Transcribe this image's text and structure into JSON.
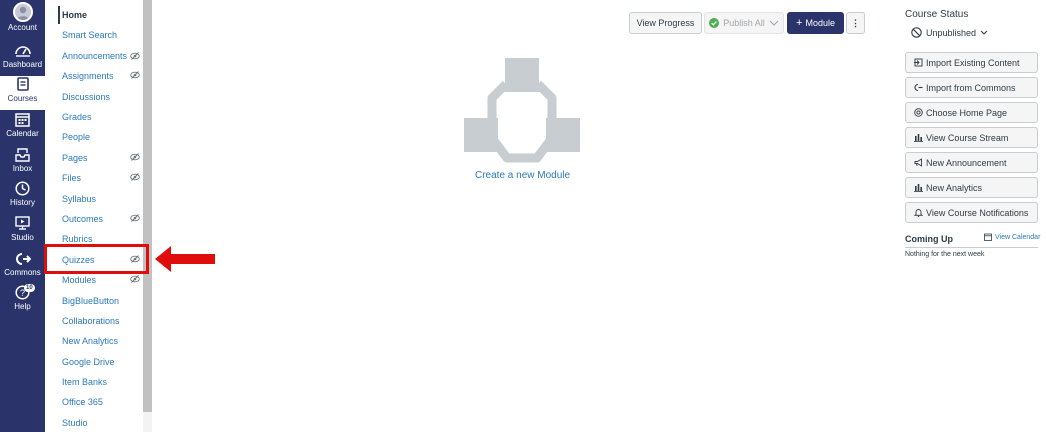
{
  "global_nav": {
    "items": [
      {
        "label": "Account",
        "icon": "account-avatar-icon"
      },
      {
        "label": "Dashboard",
        "icon": "dashboard-icon"
      },
      {
        "label": "Courses",
        "icon": "courses-icon",
        "active": true
      },
      {
        "label": "Calendar",
        "icon": "calendar-icon"
      },
      {
        "label": "Inbox",
        "icon": "inbox-icon"
      },
      {
        "label": "History",
        "icon": "history-clock-icon"
      },
      {
        "label": "Studio",
        "icon": "studio-icon"
      },
      {
        "label": "Commons",
        "icon": "commons-icon"
      },
      {
        "label": "Help",
        "icon": "help-icon",
        "badge": "10"
      }
    ]
  },
  "course_nav": {
    "items": [
      {
        "label": "Home",
        "active": true,
        "hidden": false
      },
      {
        "label": "Smart Search",
        "hidden": false
      },
      {
        "label": "Announcements",
        "hidden": true
      },
      {
        "label": "Assignments",
        "hidden": true
      },
      {
        "label": "Discussions",
        "hidden": false
      },
      {
        "label": "Grades",
        "hidden": false
      },
      {
        "label": "People",
        "hidden": false
      },
      {
        "label": "Pages",
        "hidden": true
      },
      {
        "label": "Files",
        "hidden": true
      },
      {
        "label": "Syllabus",
        "hidden": false
      },
      {
        "label": "Outcomes",
        "hidden": true
      },
      {
        "label": "Rubrics",
        "hidden": false
      },
      {
        "label": "Quizzes",
        "hidden": true,
        "highlighted": true
      },
      {
        "label": "Modules",
        "hidden": true
      },
      {
        "label": "BigBlueButton",
        "hidden": false
      },
      {
        "label": "Collaborations",
        "hidden": false
      },
      {
        "label": "New Analytics",
        "hidden": false
      },
      {
        "label": "Google Drive",
        "hidden": false
      },
      {
        "label": "Item Banks",
        "hidden": false
      },
      {
        "label": "Office 365",
        "hidden": false
      },
      {
        "label": "Studio",
        "hidden": false
      }
    ]
  },
  "toolbar": {
    "view_progress": "View Progress",
    "publish_all": "Publish All",
    "add_module": "Module",
    "add_module_prefix": "+",
    "more_options": "⋮"
  },
  "empty_state": {
    "link": "Create a new Module"
  },
  "sidebar": {
    "course_status_title": "Course Status",
    "status_value": "Unpublished",
    "buttons": [
      {
        "label": "Import Existing Content",
        "icon": "import-icon"
      },
      {
        "label": "Import from Commons",
        "icon": "commons-icon"
      },
      {
        "label": "Choose Home Page",
        "icon": "target-icon"
      },
      {
        "label": "View Course Stream",
        "icon": "bar-chart-icon"
      },
      {
        "label": "New Announcement",
        "icon": "megaphone-icon"
      },
      {
        "label": "New Analytics",
        "icon": "bar-chart-icon"
      },
      {
        "label": "View Course Notifications",
        "icon": "bell-icon"
      }
    ],
    "coming_up": "Coming Up",
    "view_calendar": "View Calendar",
    "nothing_next": "Nothing for the next week"
  },
  "colors": {
    "nav_bg": "#2a346a",
    "link": "#2b7abc",
    "highlight": "#e00d0d",
    "text": "#2d3b45",
    "publish_check": "#4caf50"
  }
}
